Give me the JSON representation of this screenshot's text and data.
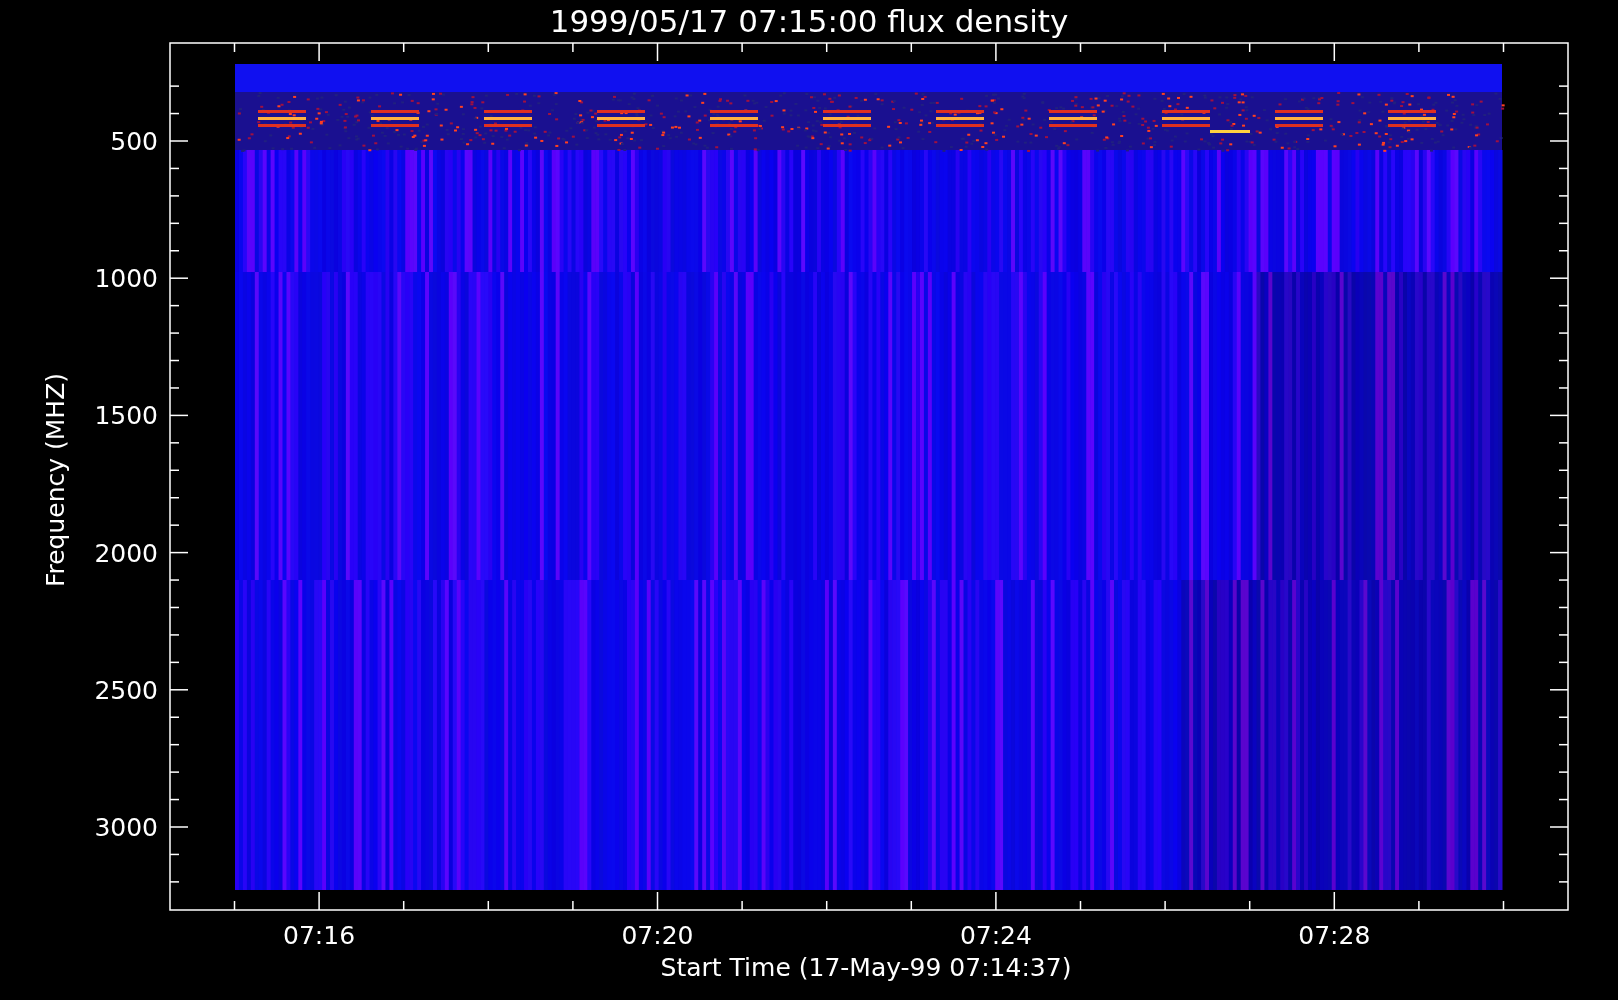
{
  "title": "1999/05/17 07:15:00 flux density",
  "y_axis": {
    "label": "Frequency (MHZ)",
    "ticks": [
      "500",
      "1000",
      "1500",
      "2000",
      "2500",
      "3000"
    ]
  },
  "x_axis": {
    "label": "Start Time (17-May-99 07:14:37)",
    "ticks": [
      "07:16",
      "07:20",
      "07:24",
      "07:28"
    ]
  }
}
